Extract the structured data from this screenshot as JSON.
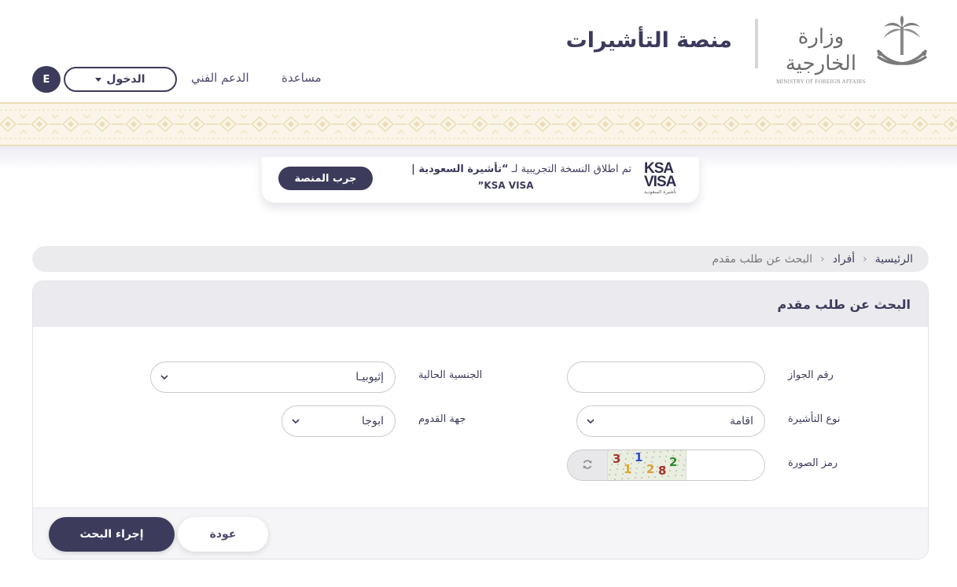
{
  "header": {
    "platform_title": "منصة التأشيرات",
    "ministry_name_ar": "وزارة الخارجية",
    "ministry_name_en": "MINISTRY OF FOREIGN AFFAIRS"
  },
  "nav": {
    "help": "مساعدة",
    "support": "الدعم الفني",
    "login": "الدخول",
    "language": "E"
  },
  "announcement": {
    "prefix": "تم اطلاق النسخة التجريبية لـ ",
    "highlight": "“تأشيرة السعودية |",
    "line2": "KSA VISA”",
    "try_button": "جرب المنصة",
    "logo_line1": "KSA",
    "logo_line2a": "VISA",
    "logo_line2b": "",
    "logo_sub": "تأشيرة السعودية"
  },
  "breadcrumb": {
    "items": [
      "الرئيسية",
      "أفراد",
      "البحث عن طلب مقدم"
    ]
  },
  "form": {
    "title": "البحث عن طلب مقدم",
    "passport_label": "رقم الجواز",
    "passport_value": "",
    "nationality_label": "الجنسية الحالية",
    "nationality_value": "إثيوبيـا",
    "visa_type_label": "نوع التأشيرة",
    "visa_type_value": "اقامة",
    "arrival_label": "جهة القدوم",
    "arrival_value": "ابوجا",
    "captcha_label": "رمز الصورة",
    "captcha_value": "",
    "captcha_digits": [
      "3",
      "1",
      "1",
      "2",
      "8",
      "2"
    ],
    "search_button": "إجراء البحث",
    "back_button": "عودة"
  },
  "colors": {
    "primary": "#3c3b5c",
    "accent_purple": "#6f4fc9",
    "pattern_gold": "#eadcb6",
    "captcha_colors": [
      "#a8322c",
      "#e0a52b",
      "#2a4fd4",
      "#d9a13a",
      "#a8322c",
      "#2c8a2c"
    ]
  },
  "icons": {
    "emblem": "saudi-emblem-icon",
    "login_caret": "caret-down-icon",
    "refresh": "refresh-icon",
    "select_chevron": "chevron-down-icon"
  }
}
